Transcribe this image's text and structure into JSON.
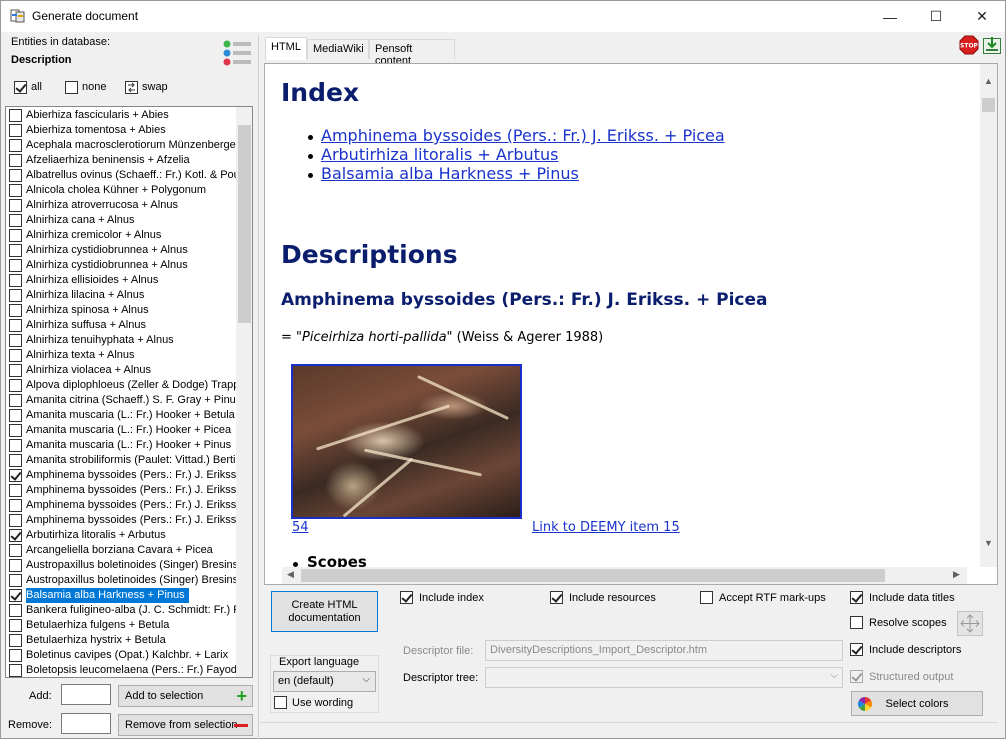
{
  "window": {
    "title": "Generate document",
    "minimize_glyph": "—",
    "maximize_glyph": "☐",
    "close_glyph": "✕"
  },
  "left_panel": {
    "entities_label": "Entities in database:",
    "entity_type": "Description",
    "all_label": "all",
    "none_label": "none",
    "swap_label": "swap",
    "items": [
      {
        "label": "Abierhiza fascicularis + Abies",
        "checked": false
      },
      {
        "label": "Abierhiza tomentosa + Abies",
        "checked": false
      },
      {
        "label": "Acephala macrosclerotiorum Münzenberger & Bubner + Pinus",
        "checked": false
      },
      {
        "label": "Afzeliaerhiza beninensis + Afzelia",
        "checked": false
      },
      {
        "label": "Albatrellus ovinus (Schaeff.: Fr.) Kotl. & Pouzar + Picea",
        "checked": false
      },
      {
        "label": "Alnicola cholea Kühner + Polygonum",
        "checked": false
      },
      {
        "label": "Alnirhiza atroverrucosa + Alnus",
        "checked": false
      },
      {
        "label": "Alnirhiza cana + Alnus",
        "checked": false
      },
      {
        "label": "Alnirhiza cremicolor + Alnus",
        "checked": false
      },
      {
        "label": "Alnirhiza cystidiobrunnea + Alnus",
        "checked": false
      },
      {
        "label": "Alnirhiza cystidiobrunnea + Alnus",
        "checked": false
      },
      {
        "label": "Alnirhiza ellisioides + Alnus",
        "checked": false
      },
      {
        "label": "Alnirhiza lilacina + Alnus",
        "checked": false
      },
      {
        "label": "Alnirhiza spinosa + Alnus",
        "checked": false
      },
      {
        "label": "Alnirhiza suffusa + Alnus",
        "checked": false
      },
      {
        "label": "Alnirhiza tenuihyphata + Alnus",
        "checked": false
      },
      {
        "label": "Alnirhiza texta + Alnus",
        "checked": false
      },
      {
        "label": "Alnirhiza violacea + Alnus",
        "checked": false
      },
      {
        "label": "Alpova diplophloeus (Zeller & Dodge) Trappe & Smith + Alnus",
        "checked": false
      },
      {
        "label": "Amanita citrina (Schaeff.) S. F. Gray + Pinus",
        "checked": false
      },
      {
        "label": "Amanita muscaria (L.: Fr.) Hooker + Betula",
        "checked": false
      },
      {
        "label": "Amanita muscaria (L.: Fr.) Hooker + Picea",
        "checked": false
      },
      {
        "label": "Amanita muscaria (L.: Fr.) Hooker + Pinus",
        "checked": false
      },
      {
        "label": "Amanita strobiliformis (Paulet: Vittad.) Bertill. + Quercus",
        "checked": false
      },
      {
        "label": "Amphinema byssoides (Pers.: Fr.) J. Erikss. + Picea",
        "checked": true
      },
      {
        "label": "Amphinema byssoides (Pers.: Fr.) J. Erikss. + Pinus",
        "checked": false
      },
      {
        "label": "Amphinema byssoides (Pers.: Fr.) J. Erikss. + Fagus",
        "checked": false
      },
      {
        "label": "Amphinema byssoides (Pers.: Fr.) J. Erikss. + Abies",
        "checked": false
      },
      {
        "label": "Arbutirhiza litoralis + Arbutus",
        "checked": true
      },
      {
        "label": "Arcangeliella borziana Cavara + Picea",
        "checked": false
      },
      {
        "label": "Austropaxillus boletinoides (Singer) Bresinsky & Jarosch + Nothofagus",
        "checked": false
      },
      {
        "label": "Austropaxillus boletinoides (Singer) Bresinsky & Jarosch + Pinus",
        "checked": false
      },
      {
        "label": "Balsamia alba Harkness + Pinus",
        "checked": true,
        "selected": true
      },
      {
        "label": "Bankera fuligineo-alba (J. C. Schmidt: Fr.) Pouzar + Pinus",
        "checked": false
      },
      {
        "label": "Betulaerhiza fulgens + Betula",
        "checked": false
      },
      {
        "label": "Betulaerhiza hystrix + Betula",
        "checked": false
      },
      {
        "label": "Boletinus cavipes (Opat.) Kalchbr. + Larix",
        "checked": false
      },
      {
        "label": "Boletopsis leucomelaena (Pers.: Fr.) Fayod + Picea",
        "checked": false
      }
    ],
    "add_label": "Add:",
    "remove_label": "Remove:",
    "add_button": "Add to selection",
    "remove_button": "Remove from selection"
  },
  "tabs": [
    {
      "label": "HTML",
      "active": true
    },
    {
      "label": "MediaWiki",
      "active": false
    },
    {
      "label": "Pensoft content",
      "active": false
    }
  ],
  "document": {
    "index_heading": "Index",
    "index_links": [
      "Amphinema byssoides (Pers.: Fr.) J. Erikss. + Picea",
      "Arbutirhiza litoralis + Arbutus",
      "Balsamia alba Harkness + Pinus"
    ],
    "descriptions_heading": "Descriptions",
    "entry_heading": "Amphinema byssoides (Pers.: Fr.) J. Erikss. + Picea",
    "synonym_prefix": "= ",
    "synonym_name": "\"Piceirhiza horti-pallida\"",
    "synonym_ref": " (Weiss & Agerer 1988)",
    "image_caption": "54",
    "deemy_link": "Link to DEEMY item 15",
    "next_bullet": "Scopes"
  },
  "options": {
    "generate_button": "Create HTML documentation",
    "include_index": {
      "label": "Include index",
      "checked": true
    },
    "include_resources": {
      "label": "Include resources",
      "checked": true
    },
    "accept_rtf": {
      "label": "Accept RTF mark-ups",
      "checked": false
    },
    "include_data_titles": {
      "label": "Include data titles",
      "checked": true
    },
    "resolve_scopes": {
      "label": "Resolve scopes",
      "checked": false
    },
    "include_descriptors": {
      "label": "Include descriptors",
      "checked": true
    },
    "structured_output": {
      "label": "Structured output",
      "checked": true
    },
    "descriptor_file_label": "Descriptor file:",
    "descriptor_file_value": "DiversityDescriptions_Import_Descriptor.htm",
    "descriptor_tree_label": "Descriptor tree:",
    "descriptor_tree_value": "",
    "export_language_label": "Export language",
    "export_language_value": "en (default)",
    "use_wording": {
      "label": "Use wording",
      "checked": false
    },
    "select_colors_button": "Select colors"
  },
  "colors": {
    "heading": "#0b1e6e",
    "link": "#1a33cc",
    "selection": "#0078d7",
    "stop_button": "#d81e1e",
    "add_plus": "#22a020",
    "remove_minus": "#d81e1e"
  }
}
